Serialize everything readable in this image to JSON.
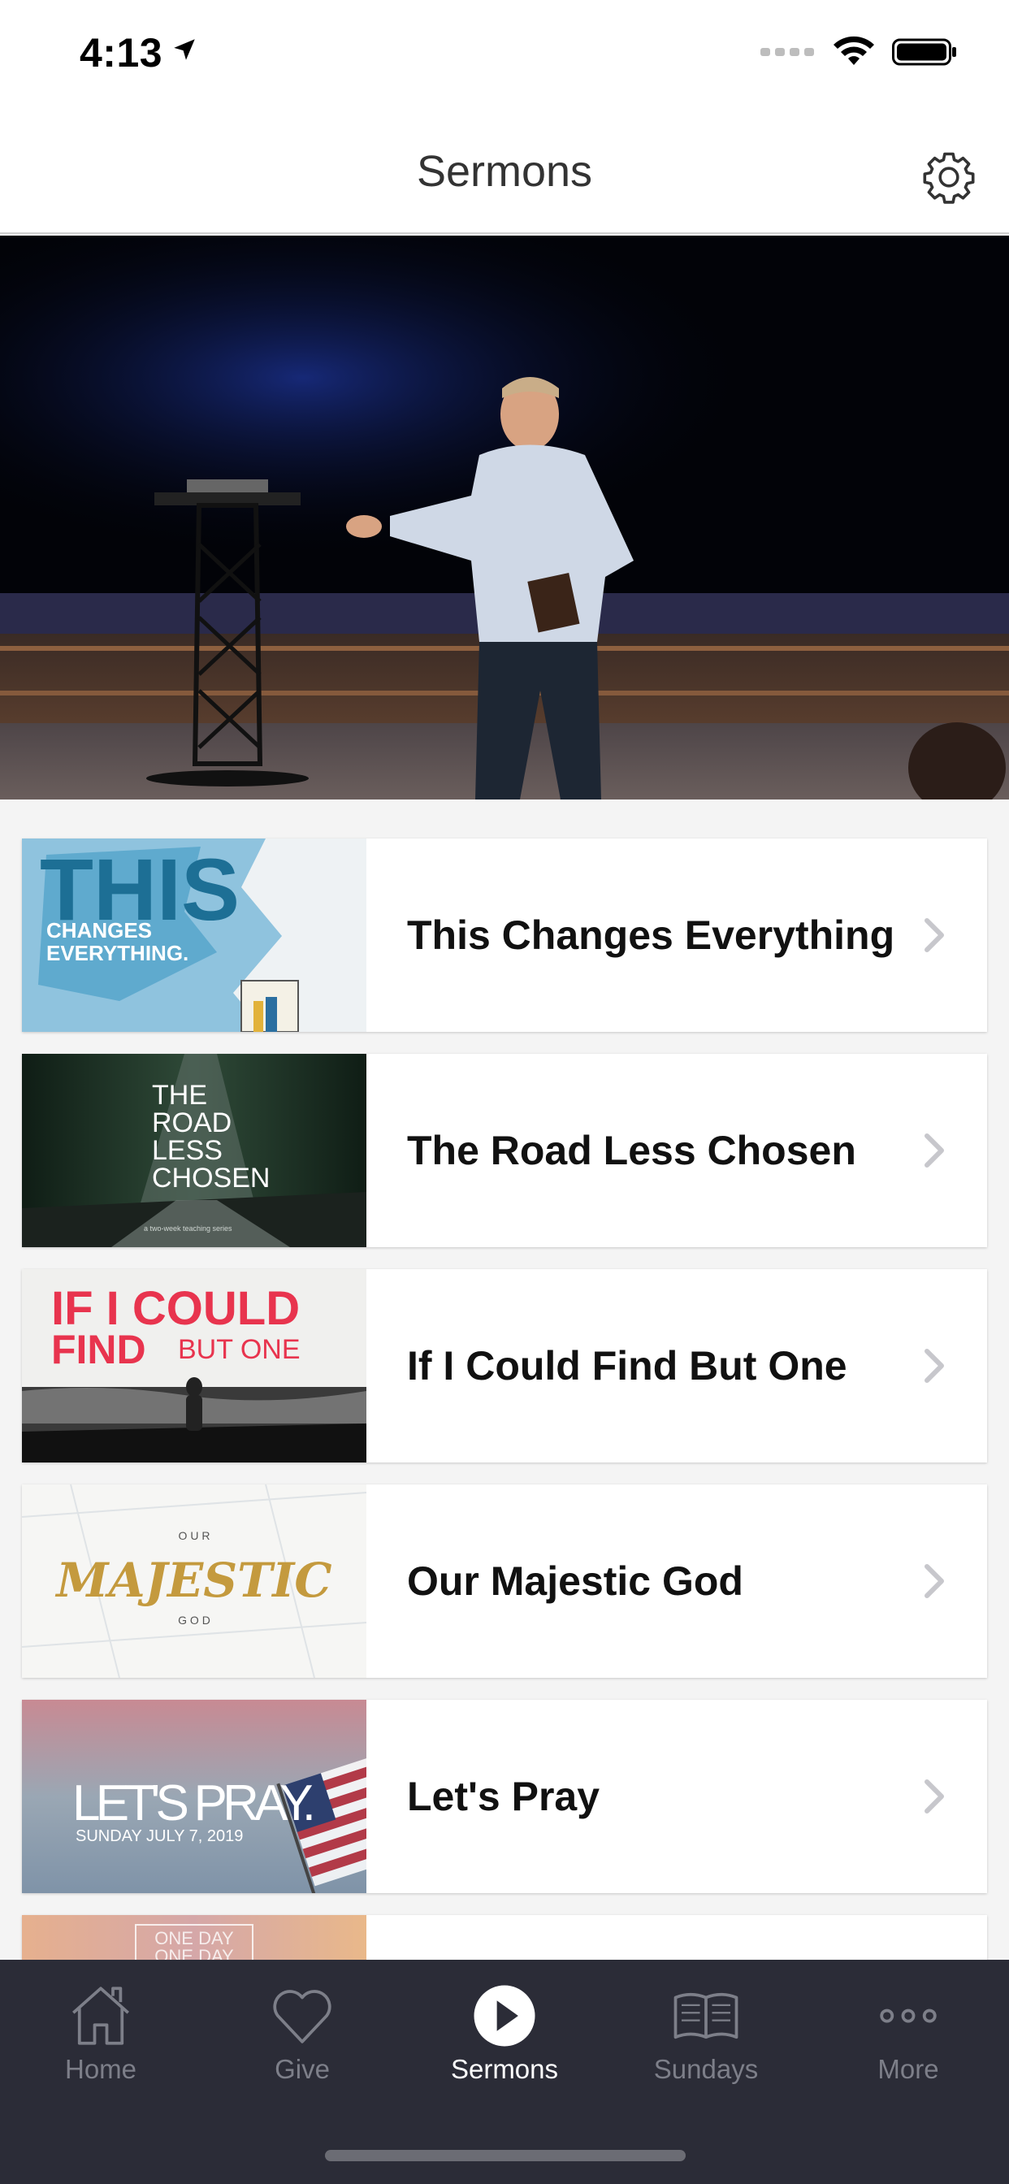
{
  "status_bar": {
    "time": "4:13"
  },
  "header": {
    "title": "Sermons"
  },
  "sermons": [
    {
      "title": "This Changes Everything",
      "thumb_big": "THIS",
      "thumb_line1": "CHANGES",
      "thumb_line2": "EVERYTHING."
    },
    {
      "title": "The Road Less Chosen",
      "thumb_words": [
        "THE",
        "ROAD",
        "LESS",
        "CHOSEN"
      ],
      "thumb_sub": "a two-week teaching series"
    },
    {
      "title": "If I Could Find But One",
      "thumb_line1": "IF I COULD",
      "thumb_line2a": "FIND",
      "thumb_line2b": "BUT ONE"
    },
    {
      "title": "Our Majestic God",
      "thumb_top": "O U R",
      "thumb_big": "MAJESTIC",
      "thumb_bottom": "G O D"
    },
    {
      "title": "Let's Pray",
      "thumb_big": "LET'S PRAY.",
      "thumb_sub": "SUNDAY JULY 7, 2019"
    },
    {
      "title": "",
      "thumb_line1": "ONE DAY",
      "thumb_line2": "ONE DAY"
    }
  ],
  "tabs": [
    {
      "label": "Home",
      "icon": "home-icon"
    },
    {
      "label": "Give",
      "icon": "heart-icon"
    },
    {
      "label": "Sermons",
      "icon": "play-icon",
      "active": true
    },
    {
      "label": "Sundays",
      "icon": "book-icon"
    },
    {
      "label": "More",
      "icon": "more-icon"
    }
  ],
  "colors": {
    "tab_bar": "#2b2c37",
    "tab_inactive": "#7d7f89",
    "tab_active": "#ffffff",
    "accent_red": "#e8344e"
  }
}
